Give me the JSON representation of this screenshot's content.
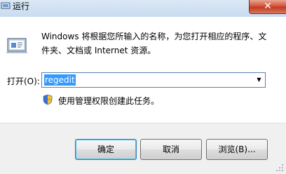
{
  "window": {
    "title": "运行",
    "close_glyph": "✕",
    "icon": "run-app-icon"
  },
  "main": {
    "description": "Windows 将根据您所输入的名称，为您打开相应的程序、文件夹、文档或 Internet 资源。",
    "open_label": "打开(O):",
    "input_value": "regedit",
    "dropdown_glyph": "▼",
    "admin_note": "使用管理权限创建此任务。",
    "shield_icon": "uac-shield-icon"
  },
  "buttons": {
    "ok": "确定",
    "cancel": "取消",
    "browse": "浏览(B)..."
  },
  "colors": {
    "selection": "#3399ff",
    "title_bar": "#c9dcf0",
    "close_button": "#c43b22"
  }
}
